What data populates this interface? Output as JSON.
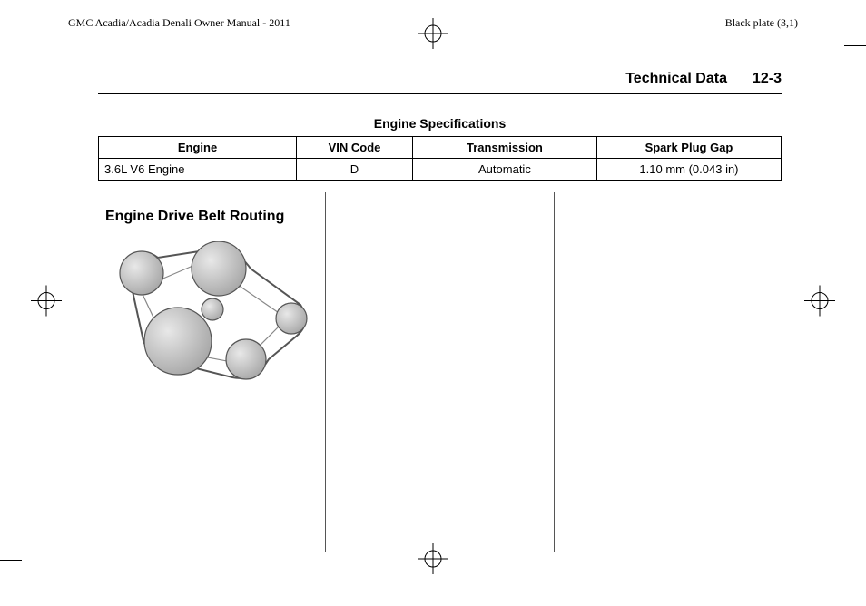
{
  "top": {
    "manual_title": "GMC Acadia/Acadia Denali Owner Manual - 2011",
    "plate_label": "Black plate (3,1)"
  },
  "section": {
    "title": "Technical Data",
    "page_num": "12-3"
  },
  "table": {
    "title": "Engine Specifications",
    "headers": {
      "engine": "Engine",
      "vin": "VIN Code",
      "trans": "Transmission",
      "spark": "Spark Plug Gap"
    },
    "rows": [
      {
        "engine": "3.6L V6 Engine",
        "vin": "D",
        "trans": "Automatic",
        "spark": "1.10 mm (0.043 in)"
      }
    ]
  },
  "belt_heading": "Engine Drive Belt Routing"
}
